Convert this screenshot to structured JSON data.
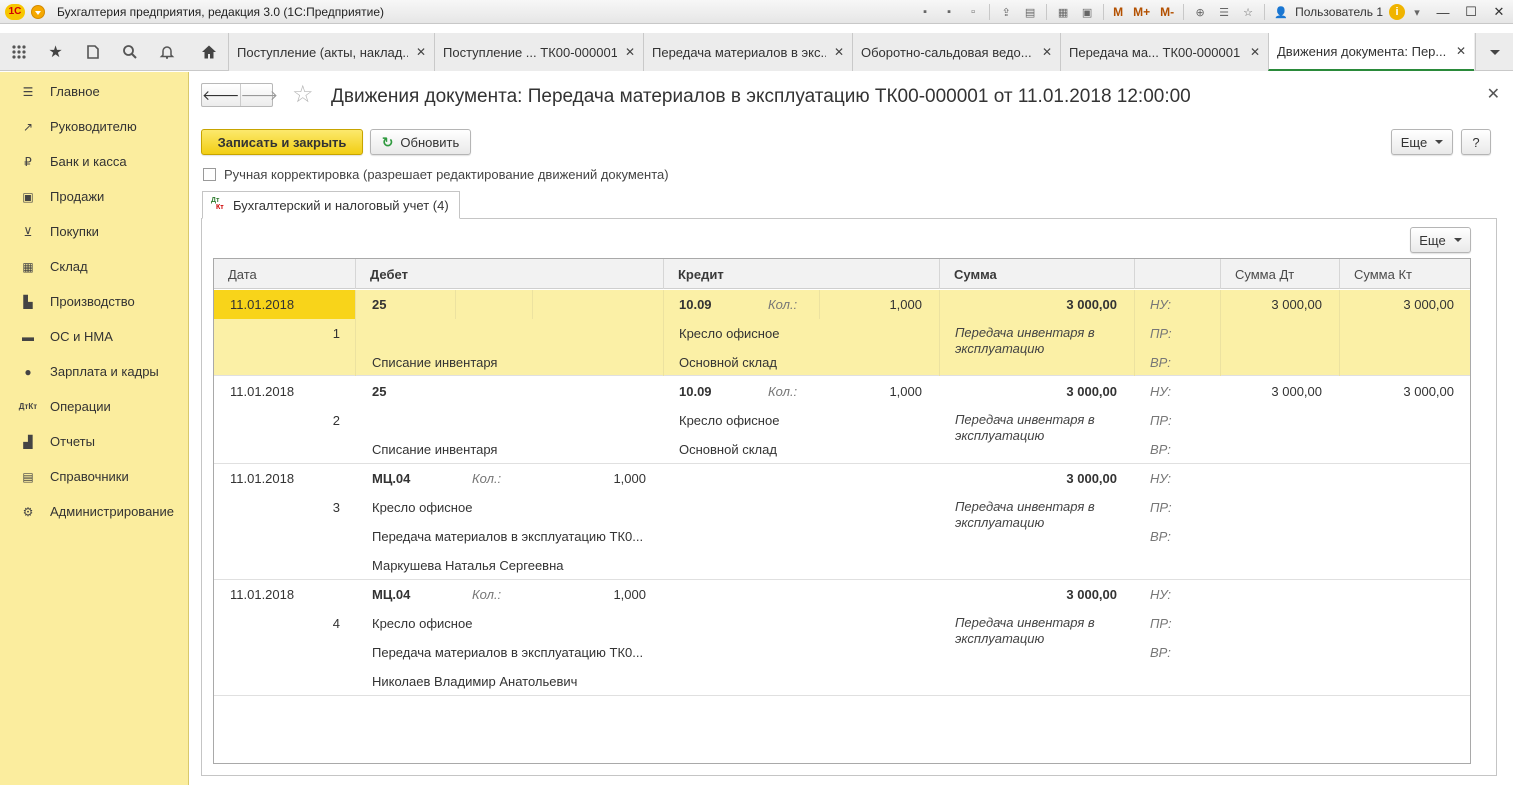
{
  "app": {
    "title": "Бухгалтерия предприятия, редакция 3.0  (1С:Предприятие)",
    "logo_text": "1С",
    "user": "Пользователь 1",
    "toolbar_m": "M",
    "toolbar_mplus": "M+",
    "toolbar_mminus": "M-"
  },
  "tabs": [
    {
      "label": "Поступление (акты, наклад..."
    },
    {
      "label": "Поступление ...  ТК00-000001"
    },
    {
      "label": "Передача материалов в экс..."
    },
    {
      "label": "Оборотно-сальдовая ведо..."
    },
    {
      "label": "Передача ма...  ТК00-000001"
    },
    {
      "label": "Движения документа: Пер..."
    }
  ],
  "sidebar": {
    "items": [
      {
        "label": "Главное",
        "icon": "menu-lines-icon"
      },
      {
        "label": "Руководителю",
        "icon": "trend-chart-icon"
      },
      {
        "label": "Банк и касса",
        "icon": "ruble-coin-icon"
      },
      {
        "label": "Продажи",
        "icon": "shopping-bag-icon"
      },
      {
        "label": "Покупки",
        "icon": "shopping-cart-icon"
      },
      {
        "label": "Склад",
        "icon": "warehouse-grid-icon"
      },
      {
        "label": "Производство",
        "icon": "factory-icon"
      },
      {
        "label": "ОС и НМА",
        "icon": "truck-icon"
      },
      {
        "label": "Зарплата и кадры",
        "icon": "person-icon"
      },
      {
        "label": "Операции",
        "icon": "dt-kt-icon"
      },
      {
        "label": "Отчеты",
        "icon": "bar-chart-icon"
      },
      {
        "label": "Справочники",
        "icon": "book-icon"
      },
      {
        "label": "Администрирование",
        "icon": "gear-icon"
      }
    ]
  },
  "form": {
    "title": "Движения документа: Передача материалов в эксплуатацию ТК00-000001 от 11.01.2018 12:00:00",
    "write_close_label": "Записать и закрыть",
    "refresh_label": "Обновить",
    "more_label": "Еще",
    "help_label": "?",
    "manual_correction_label": "Ручная корректировка (разрешает редактирование движений документа)",
    "page_tab_label": "Бухгалтерский и налоговый учет (4)",
    "grid_more_label": "Еще"
  },
  "grid": {
    "columns": [
      "Дата",
      "Дебет",
      "Кредит",
      "Сумма",
      "",
      "Сумма Дт",
      "Сумма Кт"
    ],
    "rows": [
      {
        "date": "11.01.2018",
        "num": "1",
        "debit_account": "25",
        "debit_lines": [
          "",
          "Списание инвентаря"
        ],
        "debit_qty_label": "",
        "debit_qty": "",
        "credit_account": "10.09",
        "credit_qty_label": "Кол.:",
        "credit_qty": "1,000",
        "credit_lines": [
          "Кресло офисное",
          "Основной склад"
        ],
        "sum": "3 000,00",
        "content": "Передача инвентаря в эксплуатацию",
        "nu": "НУ:",
        "pr": "ПР:",
        "vr": "ВР:",
        "sum_dt": "3 000,00",
        "sum_kt": "3 000,00"
      },
      {
        "date": "11.01.2018",
        "num": "2",
        "debit_account": "25",
        "debit_lines": [
          "",
          "Списание инвентаря"
        ],
        "debit_qty_label": "",
        "debit_qty": "",
        "credit_account": "10.09",
        "credit_qty_label": "Кол.:",
        "credit_qty": "1,000",
        "credit_lines": [
          "Кресло офисное",
          "Основной склад"
        ],
        "sum": "3 000,00",
        "content": "Передача инвентаря в эксплуатацию",
        "nu": "НУ:",
        "pr": "ПР:",
        "vr": "ВР:",
        "sum_dt": "3 000,00",
        "sum_kt": "3 000,00"
      },
      {
        "date": "11.01.2018",
        "num": "3",
        "debit_account": "МЦ.04",
        "debit_lines": [
          "Кресло офисное",
          "Передача материалов в эксплуатацию ТК0...",
          "Маркушева Наталья Сергеевна"
        ],
        "debit_qty_label": "Кол.:",
        "debit_qty": "1,000",
        "credit_account": "",
        "credit_qty_label": "",
        "credit_qty": "",
        "credit_lines": [],
        "sum": "3 000,00",
        "content": "Передача инвентаря в эксплуатацию",
        "nu": "НУ:",
        "pr": "ПР:",
        "vr": "ВР:",
        "sum_dt": "",
        "sum_kt": ""
      },
      {
        "date": "11.01.2018",
        "num": "4",
        "debit_account": "МЦ.04",
        "debit_lines": [
          "Кресло офисное",
          "Передача материалов в эксплуатацию ТК0...",
          "Николаев Владимир Анатольевич"
        ],
        "debit_qty_label": "Кол.:",
        "debit_qty": "1,000",
        "credit_account": "",
        "credit_qty_label": "",
        "credit_qty": "",
        "credit_lines": [],
        "sum": "3 000,00",
        "content": "Передача инвентаря в эксплуатацию",
        "nu": "НУ:",
        "pr": "ПР:",
        "vr": "ВР:",
        "sum_dt": "",
        "sum_kt": ""
      }
    ]
  },
  "colors": {
    "sidebar_bg": "#fbed9e",
    "selected_row": "#fbf0a6",
    "selected_cell": "#f8d41a",
    "primary_button": "#f2ce14",
    "active_tab_accent": "#2a8a3a"
  }
}
